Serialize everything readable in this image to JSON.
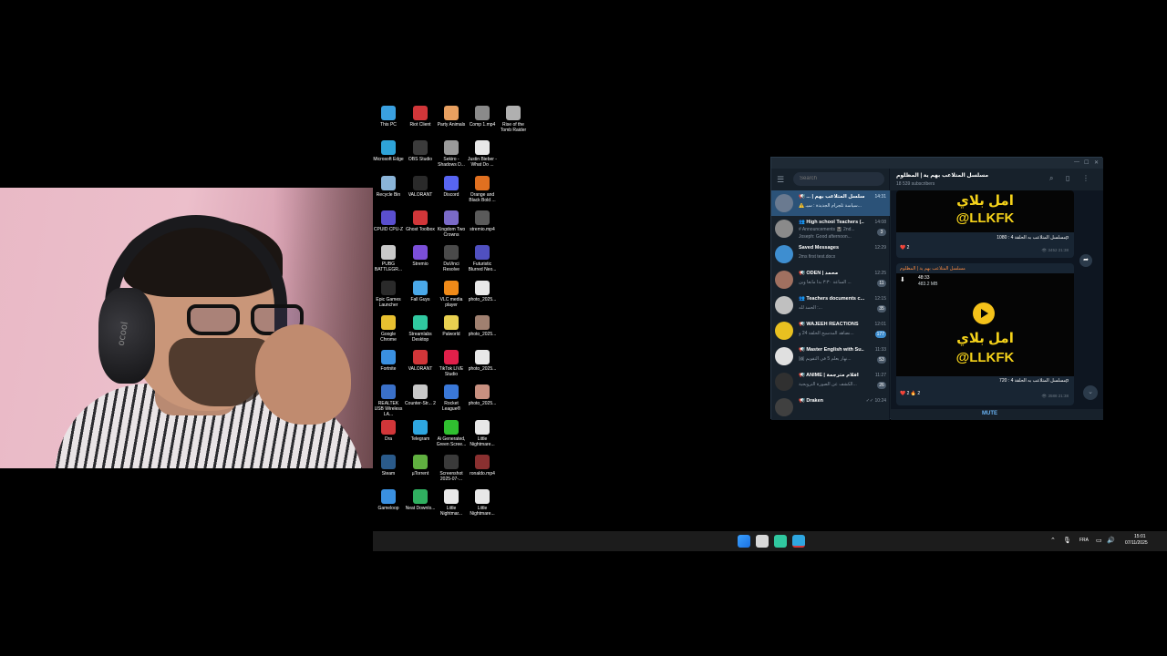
{
  "desktop_icons": [
    {
      "label": "This PC",
      "color": "#3aa0e0"
    },
    {
      "label": "Riot Client",
      "color": "#d13639"
    },
    {
      "label": "Party Animals",
      "color": "#e8a060"
    },
    {
      "label": "Comp 1.mp4",
      "color": "#8a8a8a"
    },
    {
      "label": "Rise of the Tomb Raider",
      "color": "#b0b0b0"
    },
    {
      "label": "Microsoft Edge",
      "color": "#2ea3d8"
    },
    {
      "label": "OBS Studio",
      "color": "#3b3b3b"
    },
    {
      "label": "Sekiro - Shadows D...",
      "color": "#9a9a9a"
    },
    {
      "label": "Justin Bieber - What Do ...",
      "color": "#e8e8e8"
    },
    {
      "label": "Recycle Bin",
      "color": "#8ab4d8"
    },
    {
      "label": "VALORANT",
      "color": "#2a2a2a"
    },
    {
      "label": "Discord",
      "color": "#5865f2"
    },
    {
      "label": "Orange and Black Bold ...",
      "color": "#e07020"
    },
    {
      "label": "CPUID CPU-Z",
      "color": "#5a4fcf"
    },
    {
      "label": "Ghost Toolbox",
      "color": "#d13639"
    },
    {
      "label": "Kingdom Two Crowns",
      "color": "#7a6ac8"
    },
    {
      "label": "stremio.mp4",
      "color": "#5a5a5a"
    },
    {
      "label": "PUBG BATTLEGR...",
      "color": "#c8c8c8"
    },
    {
      "label": "Stremio",
      "color": "#7b4fd8"
    },
    {
      "label": "DaVinci Resolve",
      "color": "#4a4a4a"
    },
    {
      "label": "Futuristic Blurred Neo...",
      "color": "#5050c0"
    },
    {
      "label": "Epic Games Launcher",
      "color": "#2a2a2a"
    },
    {
      "label": "Fall Guys",
      "color": "#4aa8e8"
    },
    {
      "label": "VLC media player",
      "color": "#f08a18"
    },
    {
      "label": "photo_2025...",
      "color": "#e8e8e8"
    },
    {
      "label": "Google Chrome",
      "color": "#e8c030"
    },
    {
      "label": "Streamlabs Desktop",
      "color": "#30c8a0"
    },
    {
      "label": "Palworld",
      "color": "#e8d050"
    },
    {
      "label": "photo_2025...",
      "color": "#a08070"
    },
    {
      "label": "Fortnite",
      "color": "#3a90e0"
    },
    {
      "label": "VALORANT",
      "color": "#d13639"
    },
    {
      "label": "TikTok LIVE Studio",
      "color": "#e0204a"
    },
    {
      "label": "photo_2025...",
      "color": "#e8e8e8"
    },
    {
      "label": "REALTEK USB Wireless LA...",
      "color": "#3a70c8"
    },
    {
      "label": "Counter-Str... 2",
      "color": "#c8c8c8"
    },
    {
      "label": "Rocket League®",
      "color": "#3a78d8"
    },
    {
      "label": "photo_2025...",
      "color": "#c89080"
    },
    {
      "label": "Dra",
      "color": "#d13639"
    },
    {
      "label": "Telegram",
      "color": "#2ea6e0"
    },
    {
      "label": "Ai Generated, Green Scree...",
      "color": "#30c030"
    },
    {
      "label": "Little Nightmare...",
      "color": "#e8e8e8"
    },
    {
      "label": "Steam",
      "color": "#2a5a8a"
    },
    {
      "label": "µTorrent",
      "color": "#60b040"
    },
    {
      "label": "Screenshot 2025-07-...",
      "color": "#3a3a3a"
    },
    {
      "label": "ronaldo.mp4",
      "color": "#8a3030"
    },
    {
      "label": "Gameloop",
      "color": "#3a90e0"
    },
    {
      "label": "Neat Downlo...",
      "color": "#30b060"
    },
    {
      "label": "Little Nightmar...",
      "color": "#e8e8e8"
    },
    {
      "label": "Little Nightmare...",
      "color": "#e8e8e8"
    }
  ],
  "telegram": {
    "window_controls": [
      "—",
      "☐",
      "✕"
    ],
    "search_placeholder": "Search",
    "chats": [
      {
        "name": "📢 ... | مسلسل المتلاعب بهم",
        "time": "14:31",
        "preview": "⚠️ سياسة تلجرام الجديدة : سيـ...",
        "badge": "",
        "active": true,
        "avatar": "#6a7a90"
      },
      {
        "name": "👥 High school Teachers (...",
        "time": "14:08",
        "preview": "# Announcements 📓 2nd...",
        "preview2": "Joseph: Good afternoon...",
        "badge": "3",
        "avatar": "#8a8a8a"
      },
      {
        "name": "Saved Messages",
        "time": "12:29",
        "preview": "2ms first test.docx",
        "badge": "",
        "avatar": "#3e8ed0"
      },
      {
        "name": "📢 ODEN | محمد",
        "time": "12:25",
        "preview": "الساعة ٣:٣٠ بدأ مابعا وين ...",
        "badge": "11",
        "avatar": "#a07060"
      },
      {
        "name": "👥 Teachers documents c...",
        "time": "12:15",
        "preview": "الحمد لله :...",
        "badge": "35",
        "avatar": "#c0c0c0"
      },
      {
        "name": "📢 WAJEEH REACTIONS",
        "time": "12:01",
        "preview": "نضاهد المدسيج الحلقة 24 و...",
        "badge": "177",
        "avatar": "#e8c020"
      },
      {
        "name": "📢 Master English with Su...",
        "time": "11:33",
        "preview": "🖼 نهار يعلم 5 في التقويم...",
        "badge": "53",
        "avatar": "#e0e0e0"
      },
      {
        "name": "📢 ANIME | أفلام مترجمة",
        "time": "11:27",
        "preview": "الكشف عن الصورة الترويجية...",
        "badge": "26",
        "avatar": "#303030"
      },
      {
        "name": "📢 Draken",
        "time": "✓✓ 10:24",
        "preview": "",
        "badge": "",
        "avatar": "#404040"
      }
    ],
    "channel_title": "مسلسل المتلاعب بهم ية | المظلوم",
    "channel_subscribers": "18 539 subscribers",
    "header_icons": [
      "search-icon",
      "sidebar-icon",
      "more-icon"
    ],
    "messages": [
      {
        "promo_line1": "امل بلاي",
        "promo_line2": "@LLKFK",
        "caption": "مسلسل المتلاعب به الحلقة 4 : 1080p",
        "reactions": "❤️ 2",
        "views": "👁 3452 21:38"
      },
      {
        "forward_from": "مسلسل المتلاعب بهم ية | المظلوم",
        "duration": "48:33",
        "size": "483.2 MB",
        "promo_line1": "امل بلاي",
        "promo_line2": "@LLKFK",
        "caption": "مسلسل المتلاعب به الحلقة 4 : 720p",
        "reactions": "❤️ 2   🔥 2",
        "views": "👁 3588 21:38"
      }
    ],
    "mute_label": "MUTE"
  },
  "taskbar": {
    "apps": [
      "windows-start",
      "file-explorer",
      "streamlabs",
      "telegram"
    ],
    "language": "FRA",
    "time": "15:01",
    "date": "07/11/2025"
  }
}
